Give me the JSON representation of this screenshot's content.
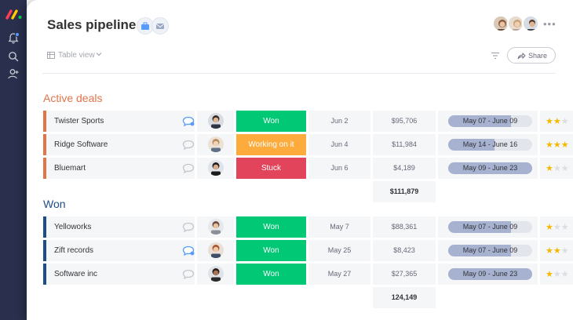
{
  "colors": {
    "rail": "#292f4c",
    "won": "#00c875",
    "working": "#fdab3d",
    "stuck": "#e2445c",
    "active_group": "#e2744a",
    "won_group": "#1d4f86",
    "star": "#f5b800"
  },
  "icons": {
    "rail": [
      "monday-logo-icon",
      "bell-icon",
      "search-icon",
      "user-icon"
    ],
    "board": [
      "briefcase-icon",
      "mail-icon"
    ],
    "view": "table-icon",
    "filter": "filter-icon",
    "share": "share-arrow-icon",
    "update": "speech-bubble-icon"
  },
  "header": {
    "title": "Sales pipeline",
    "view_label": "Table view",
    "share_label": "Share",
    "more_label": "•••"
  },
  "groups": [
    {
      "title": "Active deals",
      "color": "#e2744a",
      "rows": [
        {
          "name": "Twister Sports",
          "status": "Won",
          "status_color": "#00c875",
          "date": "Jun 2",
          "amount": "$95,706",
          "timeline": "May 07 - June 09",
          "timeline_progress": 0.75,
          "rating": 2,
          "has_update": true
        },
        {
          "name": "Ridge Software",
          "status": "Working on it",
          "status_color": "#fdab3d",
          "date": "Jun 4",
          "amount": "$11,984",
          "timeline": "May 14 - June 16",
          "timeline_progress": 0.55,
          "rating": 3,
          "has_update": false
        },
        {
          "name": "Bluemart",
          "status": "Stuck",
          "status_color": "#e2445c",
          "date": "Jun 6",
          "amount": "$4,189",
          "timeline": "May 09 - June 23",
          "timeline_progress": 1.0,
          "rating": 1,
          "has_update": false
        }
      ],
      "total": "$111,879"
    },
    {
      "title": "Won",
      "color": "#1d4f86",
      "rows": [
        {
          "name": "Yelloworks",
          "status": "Won",
          "status_color": "#00c875",
          "date": "May 7",
          "amount": "$88,361",
          "timeline": "May 07 - June 09",
          "timeline_progress": 0.75,
          "rating": 1,
          "has_update": false
        },
        {
          "name": "Zift records",
          "status": "Won",
          "status_color": "#00c875",
          "date": "May 25",
          "amount": "$8,423",
          "timeline": "May 07 - June 09",
          "timeline_progress": 0.75,
          "rating": 2,
          "has_update": true
        },
        {
          "name": "Software inc",
          "status": "Won",
          "status_color": "#00c875",
          "date": "May 27",
          "amount": "$27,365",
          "timeline": "May 09 - June 23",
          "timeline_progress": 1.0,
          "rating": 1,
          "has_update": false
        }
      ],
      "total": "124,149"
    }
  ]
}
